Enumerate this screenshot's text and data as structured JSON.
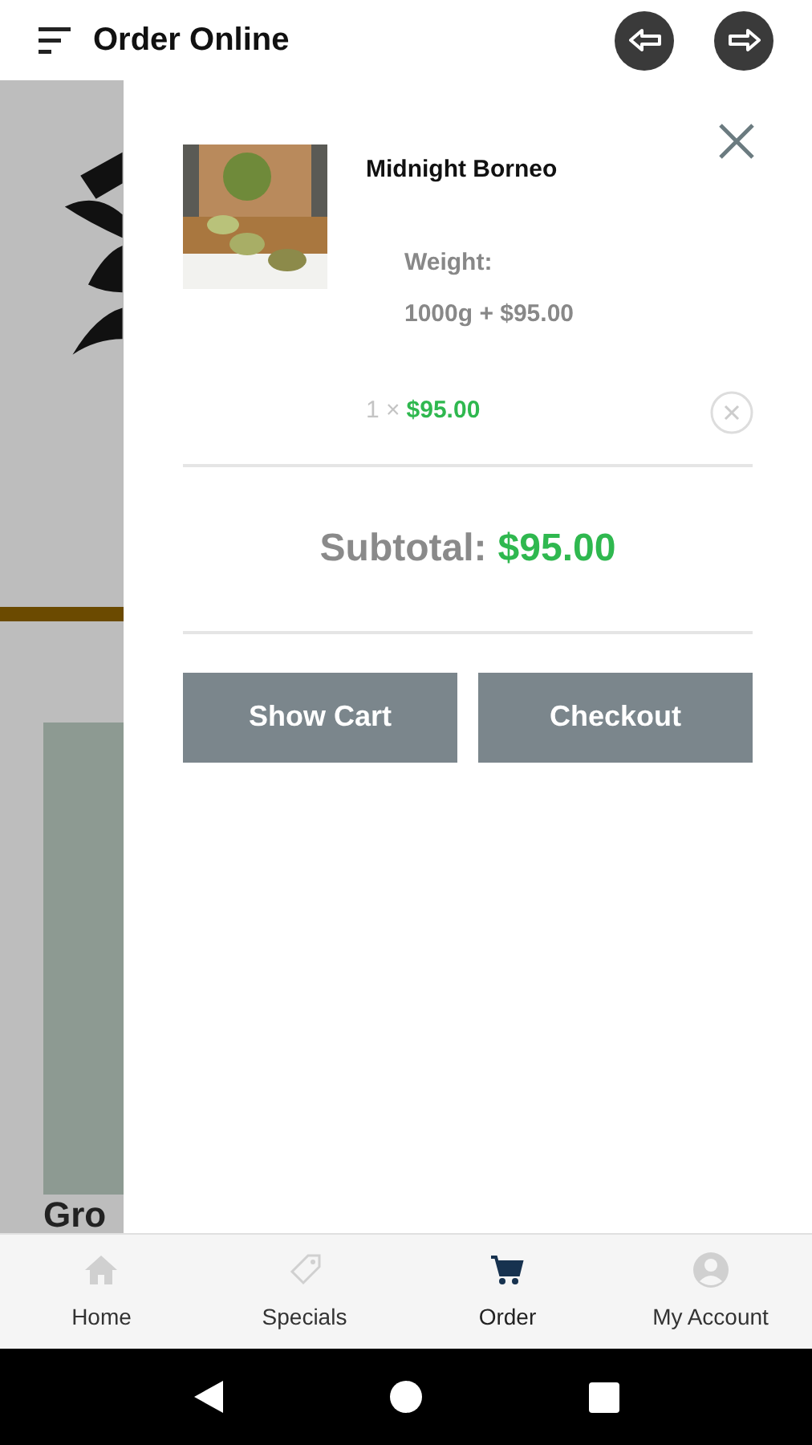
{
  "app_bar": {
    "title": "Order Online"
  },
  "background": {
    "heading": "Gro"
  },
  "cart_drawer": {
    "items": [
      {
        "kind": "picture",
        "name": "Midnight Borneo",
        "option_label": "Weight:",
        "option_value": "1000g + $95.00",
        "quantity": "1 ×",
        "price": "$95.00"
      }
    ],
    "subtotal_label": "Subtotal:",
    "subtotal_value": "$95.00",
    "buttons": [
      "Show Cart",
      "Checkout"
    ]
  },
  "bottom_nav": [
    {
      "label": "Home",
      "kind": "home",
      "selected": false
    },
    {
      "label": "Specials",
      "kind": "tag",
      "selected": false
    },
    {
      "label": "Order",
      "kind": "cart",
      "selected": true
    },
    {
      "label": "My Account",
      "kind": "account",
      "selected": false
    }
  ]
}
